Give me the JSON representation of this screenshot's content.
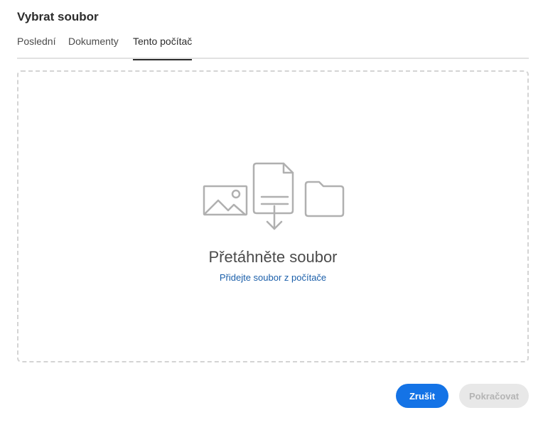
{
  "dialog": {
    "title": "Vybrat soubor"
  },
  "tabs": [
    {
      "label": "Poslední",
      "active": false
    },
    {
      "label": "Dokumenty",
      "active": false
    },
    {
      "label": "Tento počítač",
      "active": true
    }
  ],
  "dropzone": {
    "title": "Přetáhněte soubor",
    "link": "Přidejte soubor z počítače",
    "icons": [
      "image-icon",
      "document-download-icon",
      "folder-icon"
    ]
  },
  "buttons": {
    "cancel": "Zrušit",
    "continue": "Pokračovat",
    "continue_enabled": false
  },
  "colors": {
    "accent": "#1473e6",
    "link": "#1b5faa",
    "icon_gray": "#b0b0b0",
    "disabled_bg": "#e8e8e8"
  }
}
